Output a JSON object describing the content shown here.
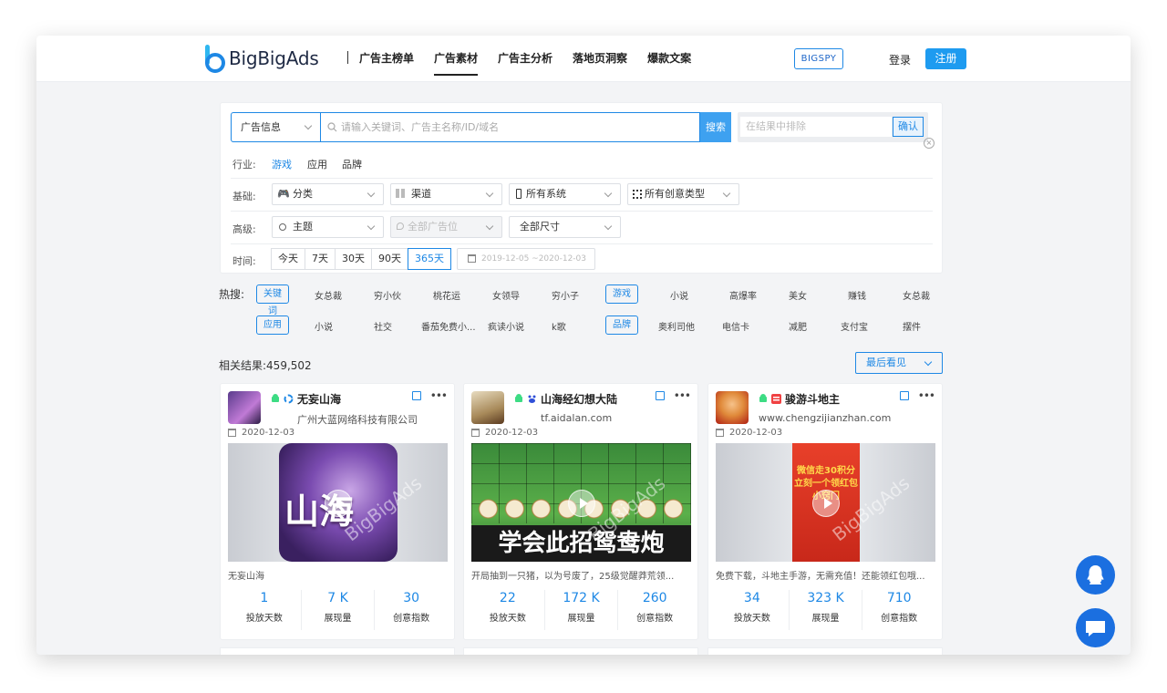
{
  "header": {
    "logo_text": "BigBigAds",
    "nav": [
      "广告主榜单",
      "广告素材",
      "广告主分析",
      "落地页洞察",
      "爆款文案"
    ],
    "active_nav": "广告素材",
    "bigspy": "BIGSPY",
    "login": "登录",
    "register": "注册"
  },
  "search": {
    "type_select": "广告信息",
    "placeholder": "请输入关键词、广告主名称/ID/域名",
    "search_btn": "搜索",
    "exclude_placeholder": "在结果中排除",
    "confirm_btn": "确认"
  },
  "filters": {
    "industry_label": "行业:",
    "industries": [
      "游戏",
      "应用",
      "品牌"
    ],
    "basic_label": "基础:",
    "category": "分类",
    "channel": "渠道",
    "system": "所有系统",
    "creative_type": "所有创意类型",
    "advanced_label": "高级:",
    "theme": "主题",
    "ad_position": "全部广告位",
    "size": "全部尺寸",
    "time_label": "时间:",
    "time_options": [
      "今天",
      "7天",
      "30天",
      "90天",
      "365天"
    ],
    "active_time": "365天",
    "date_range": "2019-12-05 ~2020-12-03"
  },
  "hot": {
    "label": "热搜:",
    "row1": [
      {
        "text": "关键词",
        "tag": true
      },
      {
        "text": "女总裁"
      },
      {
        "text": "穷小伙"
      },
      {
        "text": "桃花运"
      },
      {
        "text": "女领导"
      },
      {
        "text": "穷小子"
      },
      {
        "text": "游戏",
        "tag": true
      },
      {
        "text": "小说"
      },
      {
        "text": "高爆率"
      },
      {
        "text": "美女"
      },
      {
        "text": "赚钱"
      },
      {
        "text": "女总裁"
      }
    ],
    "row2": [
      {
        "text": "应用",
        "tag": true
      },
      {
        "text": "小说"
      },
      {
        "text": "社交"
      },
      {
        "text": "番茄免费小..."
      },
      {
        "text": "疯读小说"
      },
      {
        "text": "k歌"
      },
      {
        "text": "品牌",
        "tag": true
      },
      {
        "text": "奥利司他"
      },
      {
        "text": "电信卡"
      },
      {
        "text": "减肥"
      },
      {
        "text": "支付宝"
      },
      {
        "text": "摆件"
      }
    ]
  },
  "results": {
    "count_label": "相关结果:459,502",
    "sort": "最后看见"
  },
  "cards": [
    {
      "title": "无妄山海",
      "sub": "广州大蓝网络科技有限公司",
      "date": "2020-12-03",
      "desc": "无妄山海",
      "days": "1",
      "impressions": "7 K",
      "creative": "30",
      "media_text": "山海"
    },
    {
      "title": "山海经幻想大陆",
      "sub": "tf.aidalan.com",
      "date": "2020-12-03",
      "desc": "开局抽到一只猪，以为号废了，25级觉醒莽荒领...",
      "days": "22",
      "impressions": "172 K",
      "creative": "260",
      "media_text": "学会此招鸳鸯炮"
    },
    {
      "title": "骏游斗地主",
      "sub": "www.chengzijianzhan.com",
      "date": "2020-12-03",
      "desc": "免费下载，斗地主手游，无需充值！还能领红包哦...",
      "days": "34",
      "impressions": "323 K",
      "creative": "710",
      "media_text": "微信走30积分立刻一个领红包小窍门"
    }
  ],
  "stat_labels": {
    "days": "投放天数",
    "impressions": "展现量",
    "creative": "创意指数"
  },
  "watermark": "BigBigAds",
  "colors": {
    "accent": "#1e88e5",
    "register": "#1e9bf0",
    "float": "#1b6fe0"
  }
}
